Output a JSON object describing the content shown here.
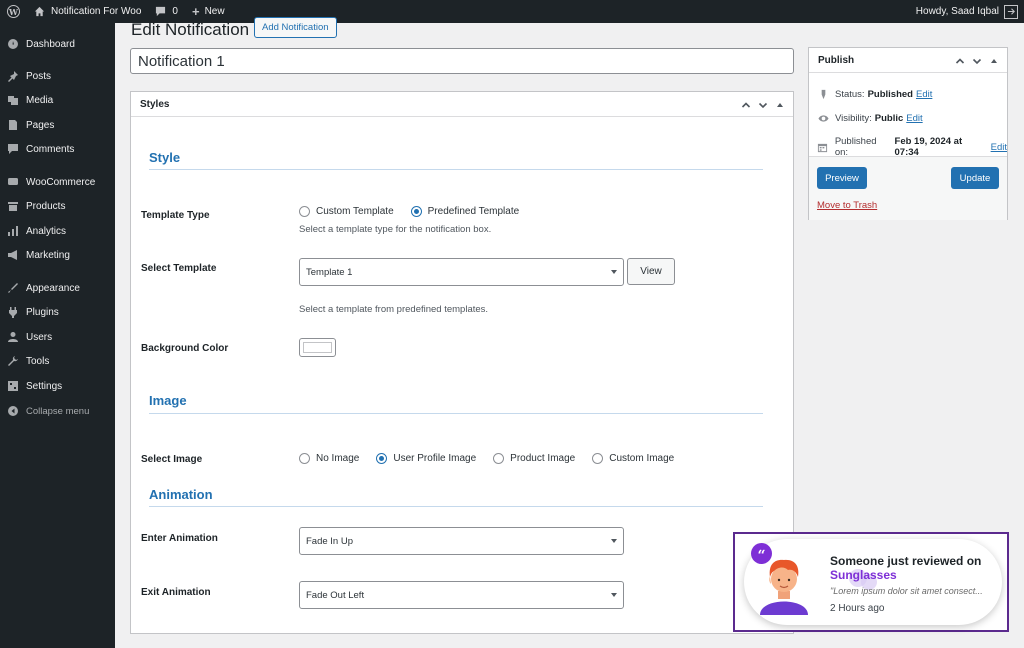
{
  "adminbar": {
    "site_name": "Notification For Woo",
    "comments_count": "0",
    "new_label": "New",
    "howdy": "Howdy, Saad Iqbal"
  },
  "sidebar": {
    "items": [
      {
        "label": "Dashboard",
        "icon": "dashboard-icon"
      },
      {
        "label": "Posts",
        "icon": "pin-icon"
      },
      {
        "label": "Media",
        "icon": "media-icon"
      },
      {
        "label": "Pages",
        "icon": "page-icon"
      },
      {
        "label": "Comments",
        "icon": "comment-icon"
      },
      {
        "label": "WooCommerce",
        "icon": "woocommerce-icon"
      },
      {
        "label": "Products",
        "icon": "archive-icon"
      },
      {
        "label": "Analytics",
        "icon": "bar-chart-icon"
      },
      {
        "label": "Marketing",
        "icon": "megaphone-icon"
      },
      {
        "label": "Appearance",
        "icon": "paintbrush-icon"
      },
      {
        "label": "Plugins",
        "icon": "plug-icon"
      },
      {
        "label": "Users",
        "icon": "user-icon"
      },
      {
        "label": "Tools",
        "icon": "wrench-icon"
      },
      {
        "label": "Settings",
        "icon": "settings-icon"
      }
    ],
    "collapse_label": "Collapse menu"
  },
  "page": {
    "title": "Edit Notification",
    "add_new": "Add Notification",
    "post_title": "Notification 1"
  },
  "styles_box": {
    "title": "Styles",
    "style_section": "Style",
    "template_type_label": "Template Type",
    "template_type_options": [
      "Custom Template",
      "Predefined Template"
    ],
    "template_type_selected": "Predefined Template",
    "template_type_help": "Select a template type for the notification box.",
    "select_template_label": "Select Template",
    "select_template_value": "Template 1",
    "view_button": "View",
    "select_template_help": "Select a template from predefined templates.",
    "background_color_label": "Background Color",
    "background_color": "#ffffff",
    "image_section": "Image",
    "select_image_label": "Select Image",
    "image_options": [
      "No Image",
      "User Profile Image",
      "Product Image",
      "Custom Image"
    ],
    "image_selected": "User Profile Image",
    "animation_section": "Animation",
    "enter_animation_label": "Enter Animation",
    "enter_animation_value": "Fade In Up",
    "exit_animation_label": "Exit Animation",
    "exit_animation_value": "Fade Out Left"
  },
  "publish_box": {
    "title": "Publish",
    "status_label": "Status:",
    "status_value": "Published",
    "visibility_label": "Visibility:",
    "visibility_value": "Public",
    "published_label": "Published on:",
    "published_value": "Feb 19, 2024 at 07:34",
    "edit_link": "Edit",
    "preview_button": "Preview",
    "update_button": "Update",
    "trash_link": "Move to Trash"
  },
  "notification_preview": {
    "title": "Someone just reviewed on",
    "product": "Sunglasses",
    "quote": "\"Lorem ipsum dolor sit amet consect...",
    "time": "2 Hours ago",
    "accent_color": "#7e2fd6",
    "border_color": "#5b2a8e"
  },
  "colors": {
    "primary": "#2271b1",
    "adminbar_bg": "#1d2327",
    "danger": "#b32d2e"
  }
}
